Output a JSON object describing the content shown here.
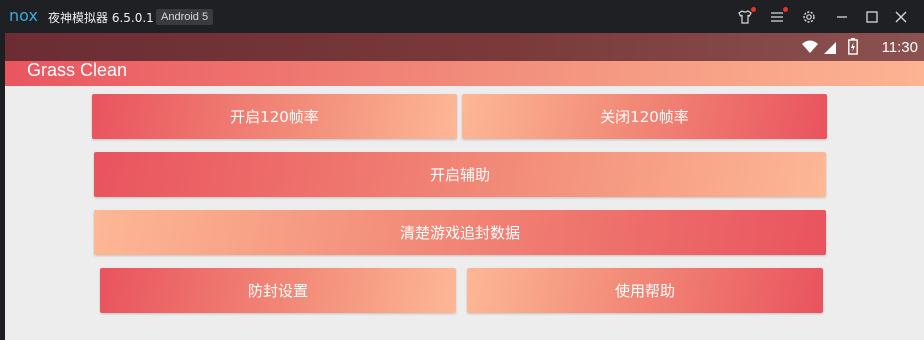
{
  "emulator": {
    "logo": "nox",
    "title": "夜神模拟器 6.5.0.1",
    "android_badge": "Android 5",
    "icons": [
      "shirt-icon",
      "menu-icon",
      "settings-icon",
      "minimize-icon",
      "maximize-icon",
      "close-icon"
    ],
    "notification_color": "#e8322e"
  },
  "status_bar": {
    "time": "11:30",
    "icons": [
      "wifi-icon",
      "signal-icon",
      "battery-icon"
    ]
  },
  "app": {
    "title": "Grass Clean",
    "accent_start": "#e9535e",
    "accent_end": "#fdb896"
  },
  "buttons": {
    "enable_120fps": "开启120帧率",
    "disable_120fps": "关闭120帧率",
    "enable_assist": "开启辅助",
    "clear_tracking_data": "清楚游戏追封数据",
    "anti_ban_settings": "防封设置",
    "help": "使用帮助"
  }
}
